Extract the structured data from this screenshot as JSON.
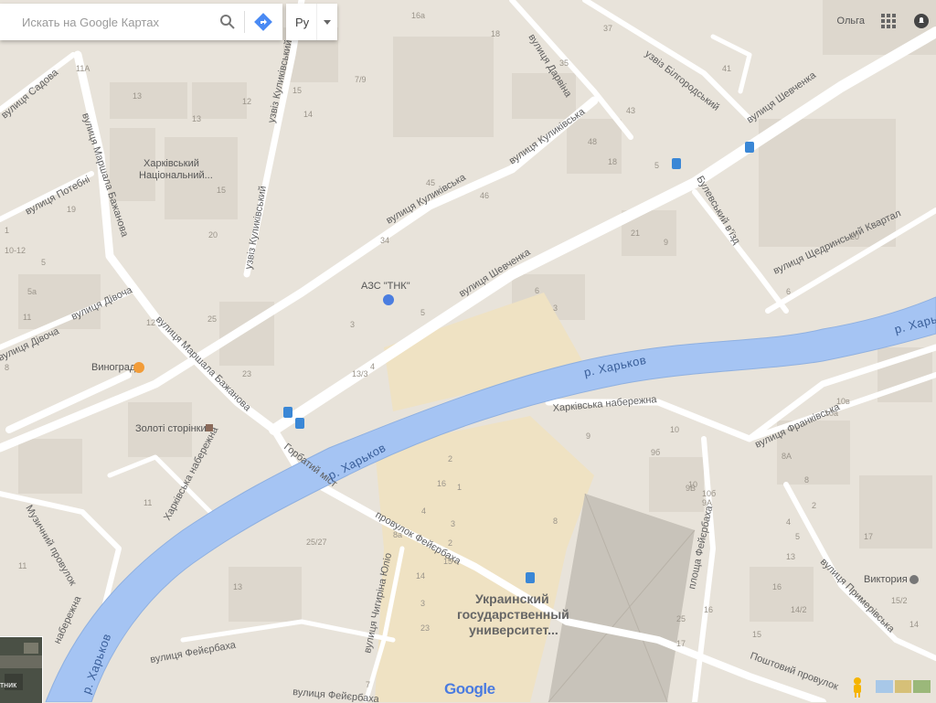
{
  "search": {
    "placeholder": "Искать на Google Картах"
  },
  "language": {
    "label": "Ру"
  },
  "user": {
    "name": "Ольга"
  },
  "icons": {
    "search": "search-icon",
    "directions": "directions-icon",
    "dropdown": "chevron-down-icon",
    "apps": "apps-grid-icon",
    "notifications": "notifications-icon",
    "pegman": "pegman-icon"
  },
  "colors": {
    "water": "#a5c4f3",
    "land": "#e8e3da",
    "road": "#ffffff",
    "block": "#dcd6cc",
    "campus": "#ede0c0"
  },
  "satellite": {
    "label": "тник"
  },
  "attribution": {
    "logo": "Google"
  },
  "rivers": [
    "р. Харьков",
    "р. Харьков",
    "р. Харьков",
    "р. Харьков"
  ],
  "streets": [
    "вулиця Шевченка",
    "вулиця Шевченка",
    "узвіз Білгородський",
    "вулиця Дарвіна",
    "вулиця Куликівська",
    "вулиця Куликівська",
    "узвіз Куликівський",
    "узвіз Куликівський",
    "вулиця Маршала Бажанова",
    "вулиця Маршала Бажанова",
    "вулиця Садова",
    "вулиця Потебні",
    "вулиця Дівоча",
    "вулиця Дівоча",
    "Харківська набережна",
    "Харківська набережна",
    "Горбатий міст",
    "Музичний провулок",
    "набережна",
    "провулок Фейєрбаха",
    "вулиця Фейєрбаха",
    "вулиця Фейєрбаха",
    "вулиця Чигиріна Юліо",
    "площа Фейєрбаха",
    "вулиця Франківська",
    "вулиця Примерівська",
    "Поштовий провулок",
    "вулиця Щедринський Квартал",
    "Булевський в'їзд"
  ],
  "pois": {
    "gas": "АЗС \"ТНК\"",
    "uni1": "Харківський",
    "uni2": "Національний...",
    "vinograd": "Виноград",
    "zoloti": "Золоті сторінки",
    "ukr1": "Украинский",
    "ukr2": "государственный",
    "ukr3": "университет...",
    "viktoriya": "Виктория"
  },
  "numbers": [
    "13",
    "12",
    "15",
    "14",
    "16а",
    "18",
    "35",
    "37",
    "41",
    "43",
    "45",
    "46",
    "48",
    "34",
    "20",
    "21",
    "18",
    "25",
    "23",
    "9",
    "7/9",
    "4",
    "5",
    "3",
    "15",
    "13",
    "11",
    "8",
    "1",
    "6",
    "3",
    "3",
    "10",
    "9",
    "8",
    "11",
    "12",
    "5",
    "5а",
    "10-12",
    "11А",
    "19",
    "11",
    "2",
    "4",
    "13",
    "14",
    "15",
    "16",
    "17",
    "20",
    "6",
    "8",
    "2",
    "5",
    "10",
    "9б",
    "9В",
    "9А",
    "10б",
    "10в",
    "10а",
    "8А",
    "4",
    "13",
    "16",
    "17",
    "16",
    "14/2",
    "15/2",
    "14",
    "15",
    "25",
    "25/27",
    "8а",
    "2",
    "13/3",
    "1",
    "5",
    "7",
    "3",
    "23",
    "21",
    "12",
    "11"
  ]
}
